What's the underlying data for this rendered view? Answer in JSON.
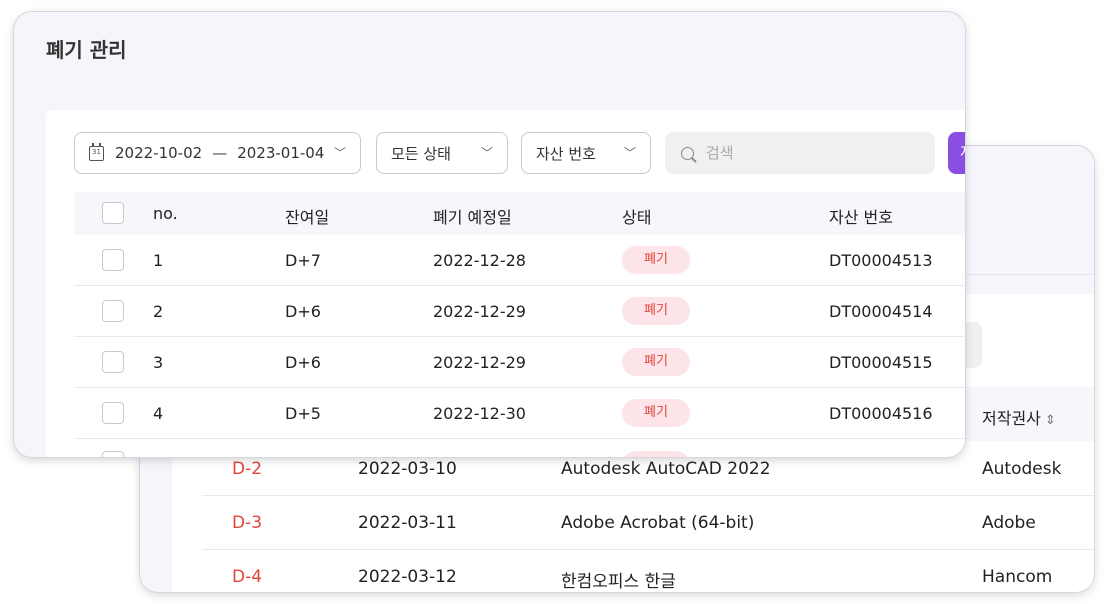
{
  "front": {
    "title": "폐기 관리",
    "date_filter": {
      "icon": "calendar-icon",
      "icon_text": "31",
      "start": "2022-10-02",
      "separator": "—",
      "end": "2023-01-04"
    },
    "status_filter": {
      "label": "모든 상태"
    },
    "asset_filter": {
      "label": "자산 번호"
    },
    "search": {
      "placeholder": "검색",
      "value": ""
    },
    "action_button": {
      "label": "저"
    },
    "columns": {
      "no": "no.",
      "remaining": "잔여일",
      "disposal_date": "폐기 예정일",
      "status": "상태",
      "asset_no": "자산 번호"
    },
    "rows": [
      {
        "no": "1",
        "remaining": "D+7",
        "disposal_date": "2022-12-28",
        "status": "폐기",
        "asset_no": "DT00004513"
      },
      {
        "no": "2",
        "remaining": "D+6",
        "disposal_date": "2022-12-29",
        "status": "폐기",
        "asset_no": "DT00004514"
      },
      {
        "no": "3",
        "remaining": "D+6",
        "disposal_date": "2022-12-29",
        "status": "폐기",
        "asset_no": "DT00004515"
      },
      {
        "no": "4",
        "remaining": "D+5",
        "disposal_date": "2022-12-30",
        "status": "폐기",
        "asset_no": "DT00004516"
      }
    ]
  },
  "back": {
    "columns": {
      "publisher": "저작권사"
    },
    "rows": [
      {
        "id": "D-2",
        "date": "2022-03-10",
        "name": "Autodesk AutoCAD 2022",
        "publisher": "Autodesk"
      },
      {
        "id": "D-3",
        "date": "2022-03-11",
        "name": "Adobe Acrobat (64-bit)",
        "publisher": "Adobe"
      },
      {
        "id": "D-4",
        "date": "2022-03-12",
        "name": "한컴오피스 한글",
        "publisher": "Hancom"
      }
    ]
  },
  "colors": {
    "accent_purple": "#8a4fe0",
    "status_red": "#e0453c",
    "badge_bg": "#fde4e8",
    "card_bg": "#f5f5fc"
  }
}
